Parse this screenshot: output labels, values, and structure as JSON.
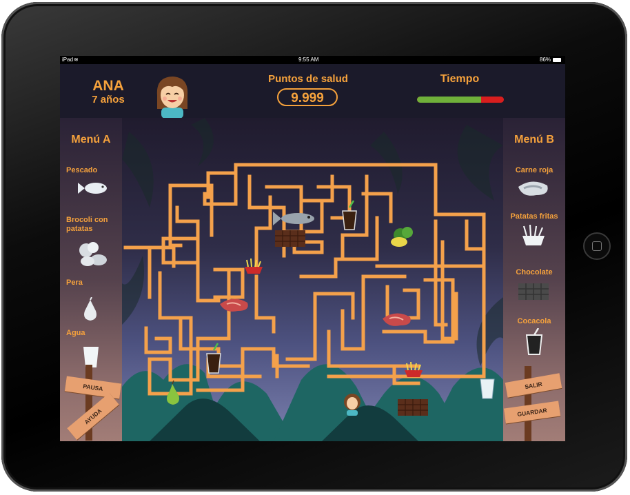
{
  "status_bar": {
    "device": "iPad",
    "time": "9:55 AM",
    "battery": "86%"
  },
  "player": {
    "name": "ANA",
    "age": "7 años"
  },
  "score": {
    "label": "Puntos de salud",
    "value": "9.999"
  },
  "timer": {
    "label": "Tiempo",
    "remaining_fraction": 0.74,
    "fill_color": "#6fb03a",
    "empty_color": "#d81e1e"
  },
  "menu_a": {
    "title": "Menú A",
    "items": [
      {
        "label": "Pescado",
        "icon": "fish-icon"
      },
      {
        "label": "Brocoli con patatas",
        "icon": "broccoli-potatoes-icon"
      },
      {
        "label": "Pera",
        "icon": "pear-icon"
      },
      {
        "label": "Agua",
        "icon": "water-glass-icon"
      }
    ]
  },
  "menu_b": {
    "title": "Menú B",
    "items": [
      {
        "label": "Carne roja",
        "icon": "steak-icon"
      },
      {
        "label": "Patatas fritas",
        "icon": "fries-icon"
      },
      {
        "label": "Chocolate",
        "icon": "chocolate-icon"
      },
      {
        "label": "Cocacola",
        "icon": "cola-glass-icon"
      }
    ]
  },
  "signs": {
    "pause": "PAUSA",
    "help": "AYUDA",
    "exit": "SALIR",
    "save": "GUARDAR"
  },
  "colors": {
    "accent": "#f6a23c",
    "maze_path": "#f4a14b",
    "sign_wood": "#e7a070"
  }
}
